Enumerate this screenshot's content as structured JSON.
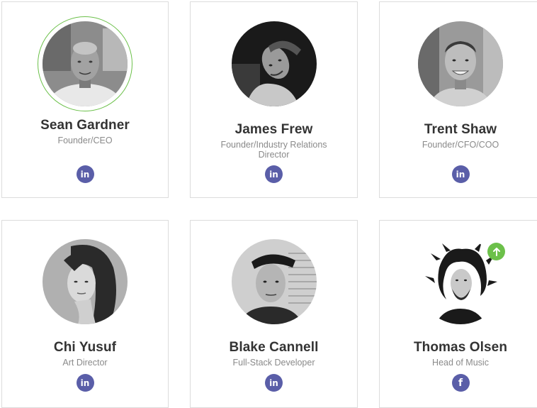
{
  "members": [
    {
      "name": "Sean Gardner",
      "role": "Founder/CEO",
      "social": "linkedin",
      "social_label": "in"
    },
    {
      "name": "James Frew",
      "role": "Founder/Industry Relations Director",
      "social": "linkedin",
      "social_label": "in"
    },
    {
      "name": "Trent Shaw",
      "role": "Founder/CFO/COO",
      "social": "linkedin",
      "social_label": "in"
    },
    {
      "name": "Chi Yusuf",
      "role": "Art Director",
      "social": "linkedin",
      "social_label": "in"
    },
    {
      "name": "Blake Cannell",
      "role": "Full-Stack Developer",
      "social": "linkedin",
      "social_label": "in"
    },
    {
      "name": "Thomas Olsen",
      "role": "Head of Music",
      "social": "facebook",
      "social_label": "f"
    }
  ],
  "colors": {
    "accent_green": "#6cc04a",
    "social_purple": "#5a5ea8",
    "name_text": "#333333",
    "role_text": "#8a8a8a"
  },
  "icons": {
    "scroll_top": "arrow-up-icon"
  }
}
